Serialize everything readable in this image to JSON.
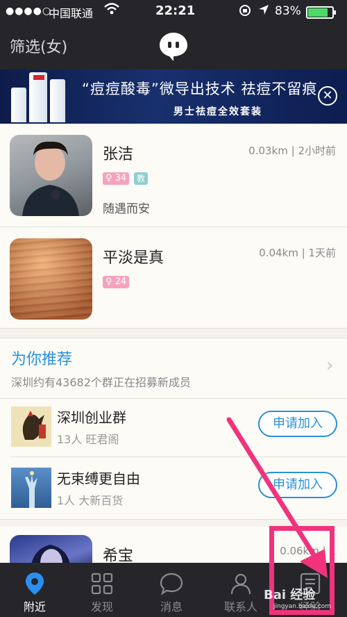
{
  "status_bar": {
    "signal": "●●●●○",
    "carrier": "中国联通",
    "time": "22:21",
    "battery": "83%",
    "battery_level": 0.83
  },
  "nav": {
    "title": "筛选(女)",
    "logo_icon": "chat-bubble-logo-icon"
  },
  "ad": {
    "headline": "“痘痘酸毒”微导出技术 祛痘不留痕",
    "subline": "男士祛痘全效套装",
    "close_icon": "close-circle-icon"
  },
  "people": [
    {
      "name": "张洁",
      "meta": "0.03km | 2小时前",
      "age": "♀ 34",
      "tag": "教",
      "signature": "随遇而安"
    },
    {
      "name": "平淡是真",
      "meta": "0.04km | 1天前",
      "age": "♀ 24"
    },
    {
      "name": "希宝",
      "meta": "0.06km | 1",
      "age": ""
    }
  ],
  "recommend": {
    "title": "为你推荐",
    "subtitle": "深圳约有43682个群正在招募新成员",
    "groups": [
      {
        "name": "深圳创业群",
        "info": "13人 旺君阁",
        "join_label": "申请加入"
      },
      {
        "name": "无束缚更自由",
        "info": "1人 大新百货",
        "join_label": "申请加入"
      }
    ]
  },
  "tabs": [
    {
      "label": "附近",
      "icon": "location-pin-icon",
      "active": true
    },
    {
      "label": "发现",
      "icon": "grid-icon"
    },
    {
      "label": "消息",
      "icon": "chat-bubble-icon"
    },
    {
      "label": "联系人",
      "icon": "person-icon"
    },
    {
      "label": "经验",
      "icon": "article-icon"
    }
  ],
  "watermark": {
    "text": "Bai 经验",
    "sub": "jingyan.baidu.com"
  },
  "colors": {
    "accent": "#2a8fd8",
    "highlight": "#f0337c",
    "bar": "#26262a",
    "active_tab": "#2b8ff0"
  }
}
